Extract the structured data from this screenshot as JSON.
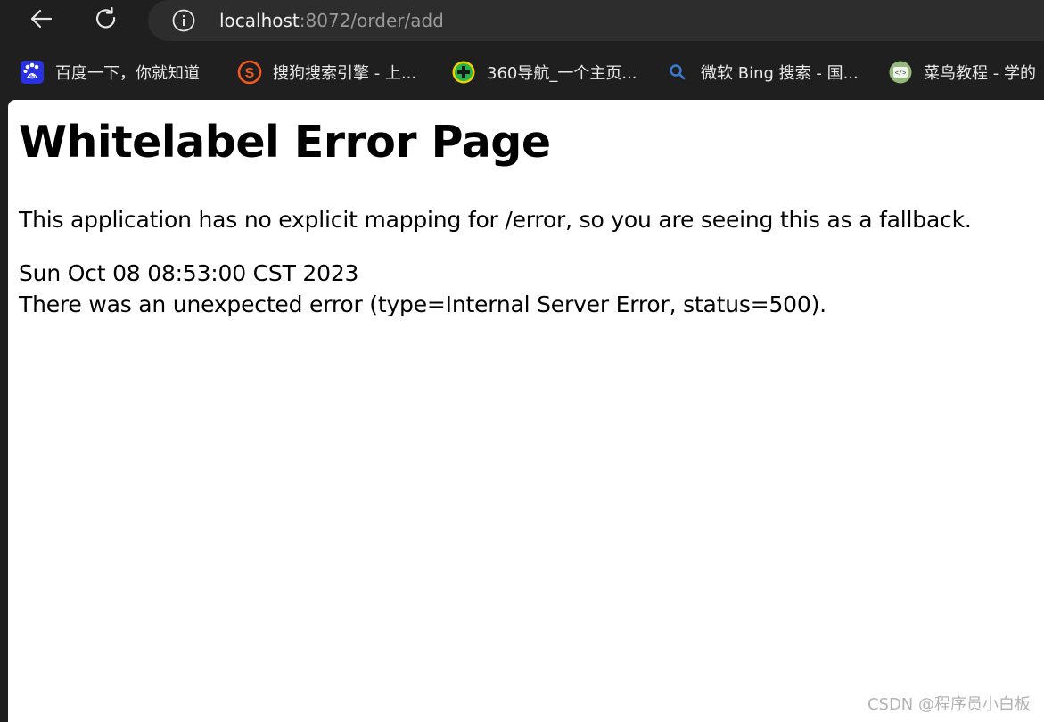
{
  "browser": {
    "url_host": "localhost",
    "url_path": ":8072/order/add"
  },
  "bookmarks": [
    {
      "label": "百度一下，你就知道",
      "icon": "baidu-icon"
    },
    {
      "label": "搜狗搜索引擎 - 上...",
      "icon": "sogou-icon"
    },
    {
      "label": "360导航_一个主页...",
      "icon": "360-icon"
    },
    {
      "label": "微软 Bing 搜索 - 国...",
      "icon": "bing-search-icon"
    },
    {
      "label": "菜鸟教程 - 学的",
      "icon": "runoob-icon"
    }
  ],
  "page": {
    "title": "Whitelabel Error Page",
    "explain": "This application has no explicit mapping for /error, so you are seeing this as a fallback.",
    "timestamp": "Sun Oct 08 08:53:00 CST 2023",
    "error": "There was an unexpected error (type=Internal Server Error, status=500)."
  },
  "watermark": "CSDN @程序员小白板",
  "colors": {
    "chrome_bg": "#1f1f1f",
    "address_bg": "#2d2d2d",
    "page_bg": "#ffffff",
    "baidu_blue": "#2932e1",
    "sogou_orange": "#f15a22",
    "green_360": "#2bb24c",
    "bing_blue": "#3a7bd5",
    "runoob_green": "#96b97d"
  }
}
